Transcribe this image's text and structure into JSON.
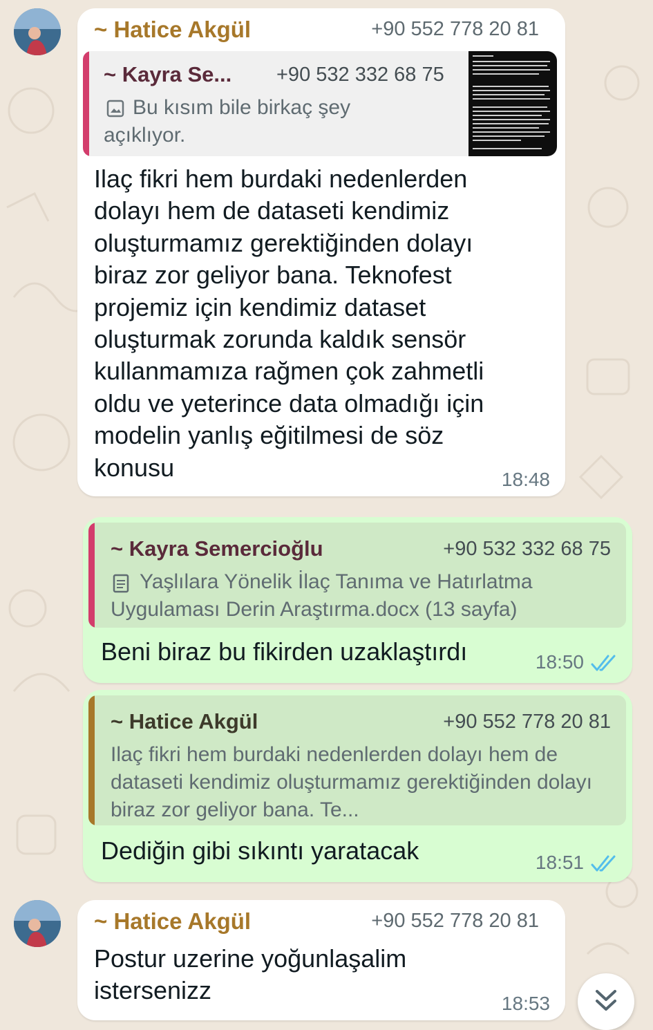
{
  "messages": [
    {
      "sender_name": "~ Hatice Akgül",
      "sender_phone": "+90 552 778 20 81",
      "quote": {
        "name": "~ Kayra Se...",
        "phone": "+90 532 332 68 75",
        "icon": "image-icon",
        "text": "Bu kısım bile birkaç şey açıklıyor."
      },
      "text": "Ilaç fikri hem burdaki nedenlerden\ndolayı hem de dataseti kendimiz\noluşturmamız gerektiğinden dolayı\nbiraz zor geliyor bana. Teknofest\nprojemiz için kendimiz dataset\noluşturmak zorunda kaldık sensör\nkullanmamıza rağmen çok zahmetli\noldu ve yeterince data olmadığı için\nmodelin yanlış eğitilmesi de söz\nkonusu",
      "time": "18:48"
    },
    {
      "quote": {
        "name": "~ Kayra Semercioğlu",
        "phone": "+90 532 332 68 75",
        "icon": "document-icon",
        "text": "Yaşlılara Yönelik İlaç Tanıma ve Hatırlatma Uygulaması Derin Araştırma.docx (13 sayfa)"
      },
      "text": "Beni biraz bu fikirden uzaklaştırdı",
      "time": "18:50",
      "status": "read-double-check"
    },
    {
      "quote": {
        "name": "~ Hatice Akgül",
        "phone": "+90 552 778 20 81",
        "text": "Ilaç fikri hem burdaki nedenlerden dolayı hem de dataseti kendimiz oluşturmamız gerektiğinden dolayı biraz zor geliyor bana. Te..."
      },
      "text": "Dediğin gibi sıkıntı yaratacak",
      "time": "18:51",
      "status": "read-double-check"
    },
    {
      "sender_name": "~ Hatice Akgül",
      "sender_phone": "+90 552 778 20 81",
      "text": "Postur uzerine yoğunlaşalim\nistersenizz",
      "time": "18:53"
    }
  ],
  "colors": {
    "background": "#efe7dc",
    "incoming_bubble": "#ffffff",
    "outgoing_bubble": "#d8fdd2",
    "sender_name": "#a7782a",
    "quote_bar_kayra": "#d33d6c",
    "quote_bar_hatice": "#a7782a",
    "read_ticks": "#53bdeb"
  },
  "icons": {
    "scroll_down": "chevron-double-down-icon"
  }
}
